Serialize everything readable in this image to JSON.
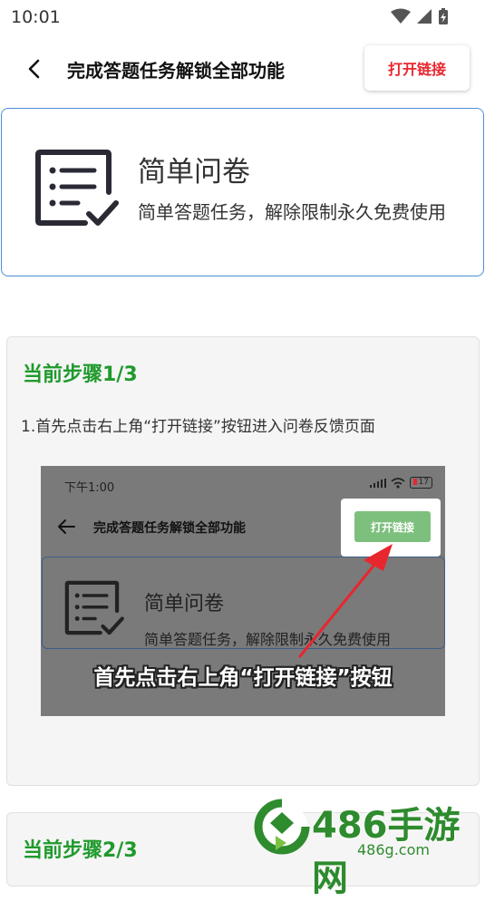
{
  "status": {
    "time": "10:01"
  },
  "header": {
    "title": "完成答题任务解锁全部功能",
    "open_link_label": "打开链接"
  },
  "survey": {
    "name": "简单问卷",
    "description": "简单答题任务，解除限制永久免费使用"
  },
  "steps": [
    {
      "title": "当前步骤1/3",
      "text": "1.首先点击右上角“打开链接”按钮进入问卷反馈页面",
      "demo": {
        "time": "下午1:00",
        "battery": "17",
        "title": "完成答题任务解锁全部功能",
        "button": "打开链接",
        "name": "简单问卷",
        "description": "简单答题任务，解除限制永久免费使用",
        "caption": "首先点击右上角“打开链接”按钮"
      }
    },
    {
      "title": "当前步骤2/3"
    }
  ],
  "watermark": {
    "brand": "486手游网",
    "url": "486g.com"
  },
  "colors": {
    "accent_red": "#e8262e",
    "step_green": "#1f9a2c",
    "card_border": "#4a90d9"
  }
}
